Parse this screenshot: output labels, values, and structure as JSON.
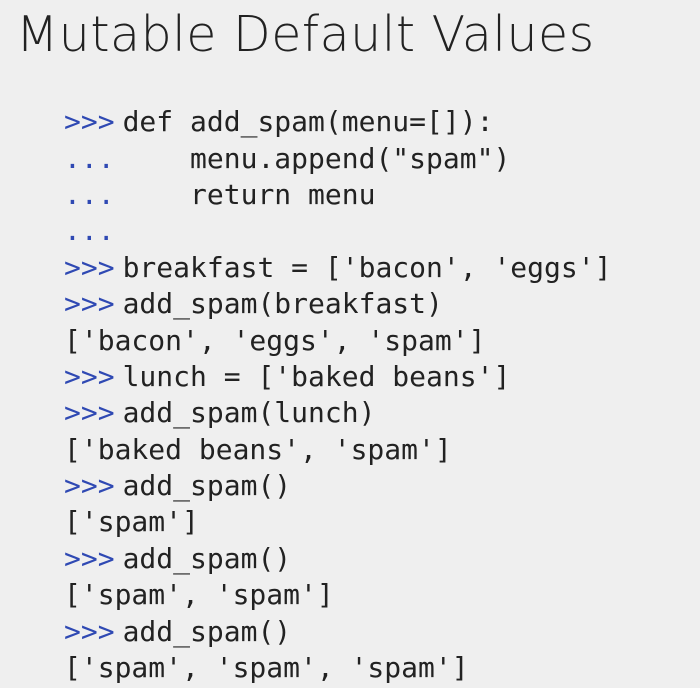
{
  "slide": {
    "title": "Mutable Default Values"
  },
  "code": {
    "lines": [
      {
        "prompt": ">>>",
        "text": "def add_spam(menu=[]):"
      },
      {
        "prompt": "...",
        "text": "    menu.append(\"spam\")"
      },
      {
        "prompt": "...",
        "text": "    return menu"
      },
      {
        "prompt": "...",
        "text": ""
      },
      {
        "prompt": ">>>",
        "text": "breakfast = ['bacon', 'eggs']"
      },
      {
        "prompt": ">>>",
        "text": "add_spam(breakfast)"
      },
      {
        "prompt": "",
        "text": "['bacon', 'eggs', 'spam']"
      },
      {
        "prompt": ">>>",
        "text": "lunch = ['baked beans']"
      },
      {
        "prompt": ">>>",
        "text": "add_spam(lunch)"
      },
      {
        "prompt": "",
        "text": "['baked beans', 'spam']"
      },
      {
        "prompt": ">>>",
        "text": "add_spam()"
      },
      {
        "prompt": "",
        "text": "['spam']"
      },
      {
        "prompt": ">>>",
        "text": "add_spam()"
      },
      {
        "prompt": "",
        "text": "['spam', 'spam']"
      },
      {
        "prompt": ">>>",
        "text": "add_spam()"
      },
      {
        "prompt": "",
        "text": "['spam', 'spam', 'spam']"
      }
    ]
  },
  "colors": {
    "background": "#efefef",
    "text": "#222222",
    "prompt": "#2f49b3"
  }
}
